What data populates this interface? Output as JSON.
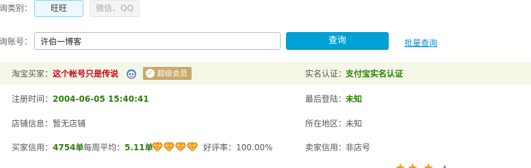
{
  "query_type": {
    "label": "询类别：",
    "options": [
      "旺旺",
      "微信、QQ"
    ],
    "selected": "旺旺"
  },
  "account": {
    "label": "询账号：",
    "value": "许伯一博客",
    "query_button": "查询",
    "batch_link": "批量查询"
  },
  "info": {
    "buyer_label": "淘宝买家：",
    "buyer_value": "这个帐号只是传说",
    "vip_badge": "超级会员",
    "realname_label": "实名认证：",
    "realname_value": "支付宝实名认证",
    "register_label": "注册时间：",
    "register_value": "2004-06-05 15:40:41",
    "last_login_label": "最后登陆：",
    "last_login_value": "未知",
    "shop_label": "店铺信息：",
    "shop_value": "暂无店铺",
    "region_label": "所在地区：",
    "region_value": "未知",
    "buyer_credit_label": "买家信用：",
    "buyer_credit_value": "4754单",
    "weekly_avg_label": "每周平均：",
    "weekly_avg_value": "5.11单",
    "diamonds": 4,
    "positive_rate_label": "好评率：",
    "positive_rate_value": "100.00%",
    "seller_credit_label": "卖家信用：",
    "seller_credit_value": "非店号"
  },
  "colors": {
    "accent": "#00a1d4",
    "band_background": "#f5f7e6",
    "red_text": "#d0021b",
    "green_text": "#2e7d0e",
    "vip": "#c9a96a",
    "diamond": "#f29a12"
  }
}
